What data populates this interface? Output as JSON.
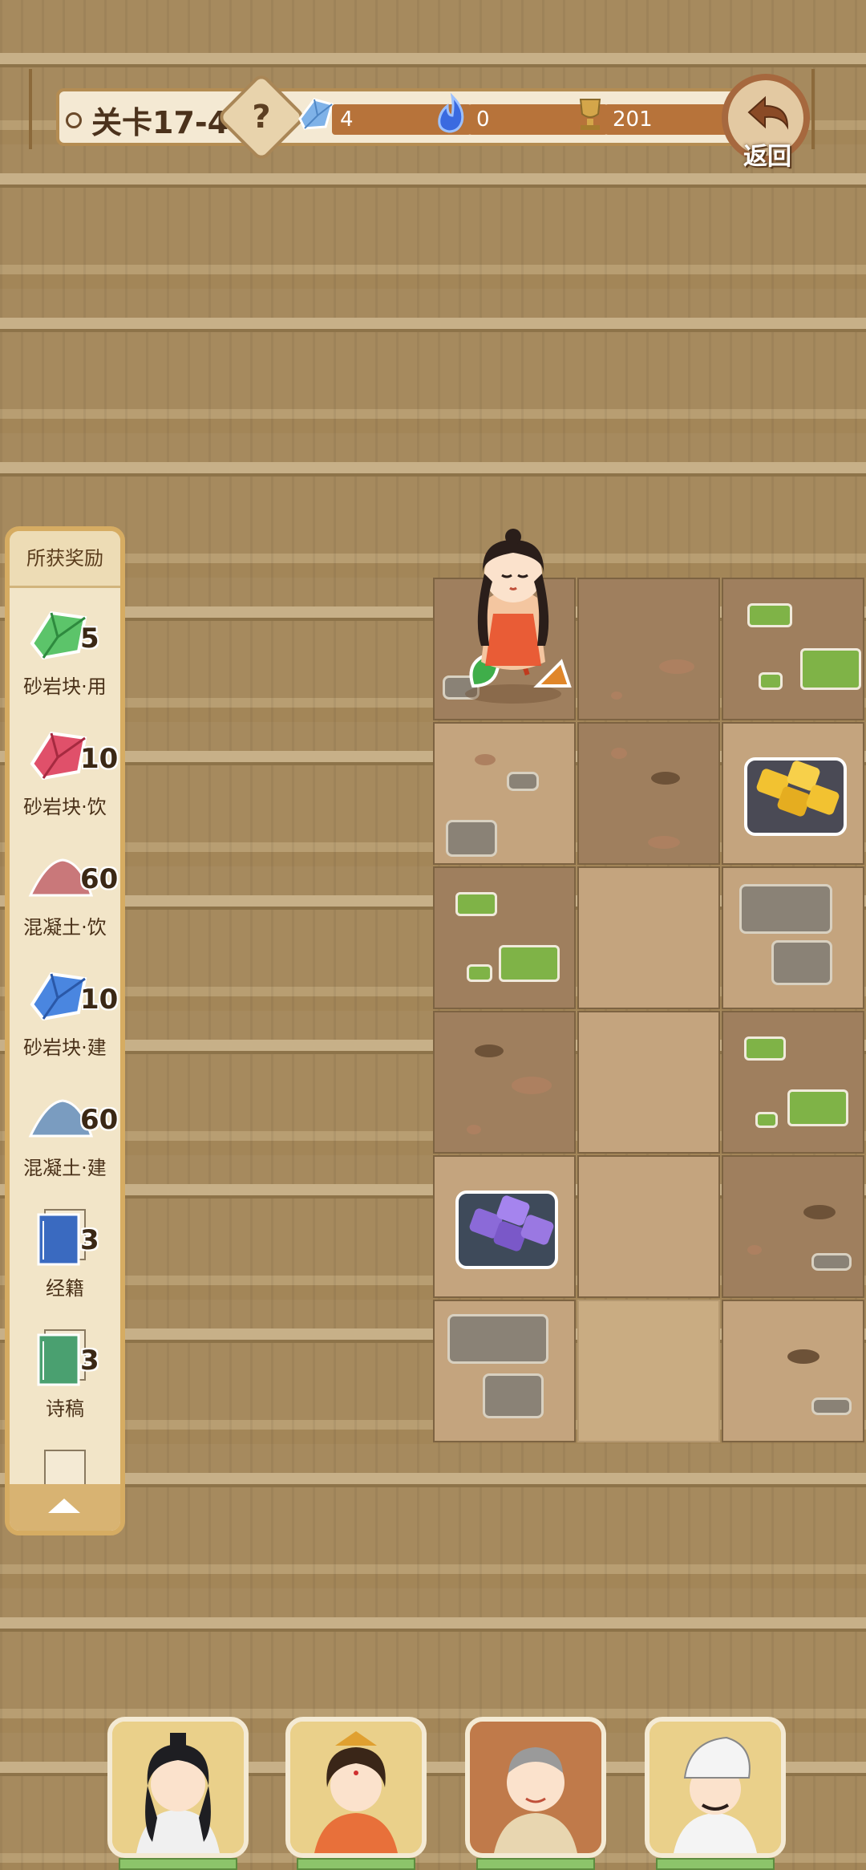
{
  "header": {
    "level": "关卡17-4",
    "help_symbol": "?",
    "resources": [
      {
        "name": "blue-crystal",
        "value": "4"
      },
      {
        "name": "blue-flame",
        "value": "0"
      },
      {
        "name": "trophy",
        "value": "201"
      }
    ],
    "back_label": "返回"
  },
  "rewards_panel": {
    "title": "所获奖励",
    "items": [
      {
        "name": "砂岩块·用",
        "count": "5",
        "icon": "green-crystal",
        "color": "#5cc46a"
      },
      {
        "name": "砂岩块·饮",
        "count": "10",
        "icon": "red-crystal",
        "color": "#e0506a"
      },
      {
        "name": "混凝土·饮",
        "count": "60",
        "icon": "red-sand-pile",
        "color": "#c9787a"
      },
      {
        "name": "砂岩块·建",
        "count": "10",
        "icon": "blue-crystal",
        "color": "#4a86e0"
      },
      {
        "name": "混凝土·建",
        "count": "60",
        "icon": "blue-sand-pile",
        "color": "#7a9cc0"
      },
      {
        "name": "经籍",
        "count": "3",
        "icon": "blue-book",
        "color": "#3a6ac0"
      },
      {
        "name": "诗稿",
        "count": "3",
        "icon": "green-book",
        "color": "#4aa070"
      }
    ]
  },
  "characters": [
    {
      "name": "scholar-hero",
      "icon": "portrait-scholar"
    },
    {
      "name": "princess-hero",
      "icon": "portrait-princess"
    },
    {
      "name": "monk-hero",
      "icon": "portrait-monk"
    },
    {
      "name": "official-hero",
      "icon": "portrait-official"
    }
  ],
  "colors": {
    "accent": "#b7733a",
    "panel_border": "#d6ac62",
    "ground": "#a68a5e"
  }
}
